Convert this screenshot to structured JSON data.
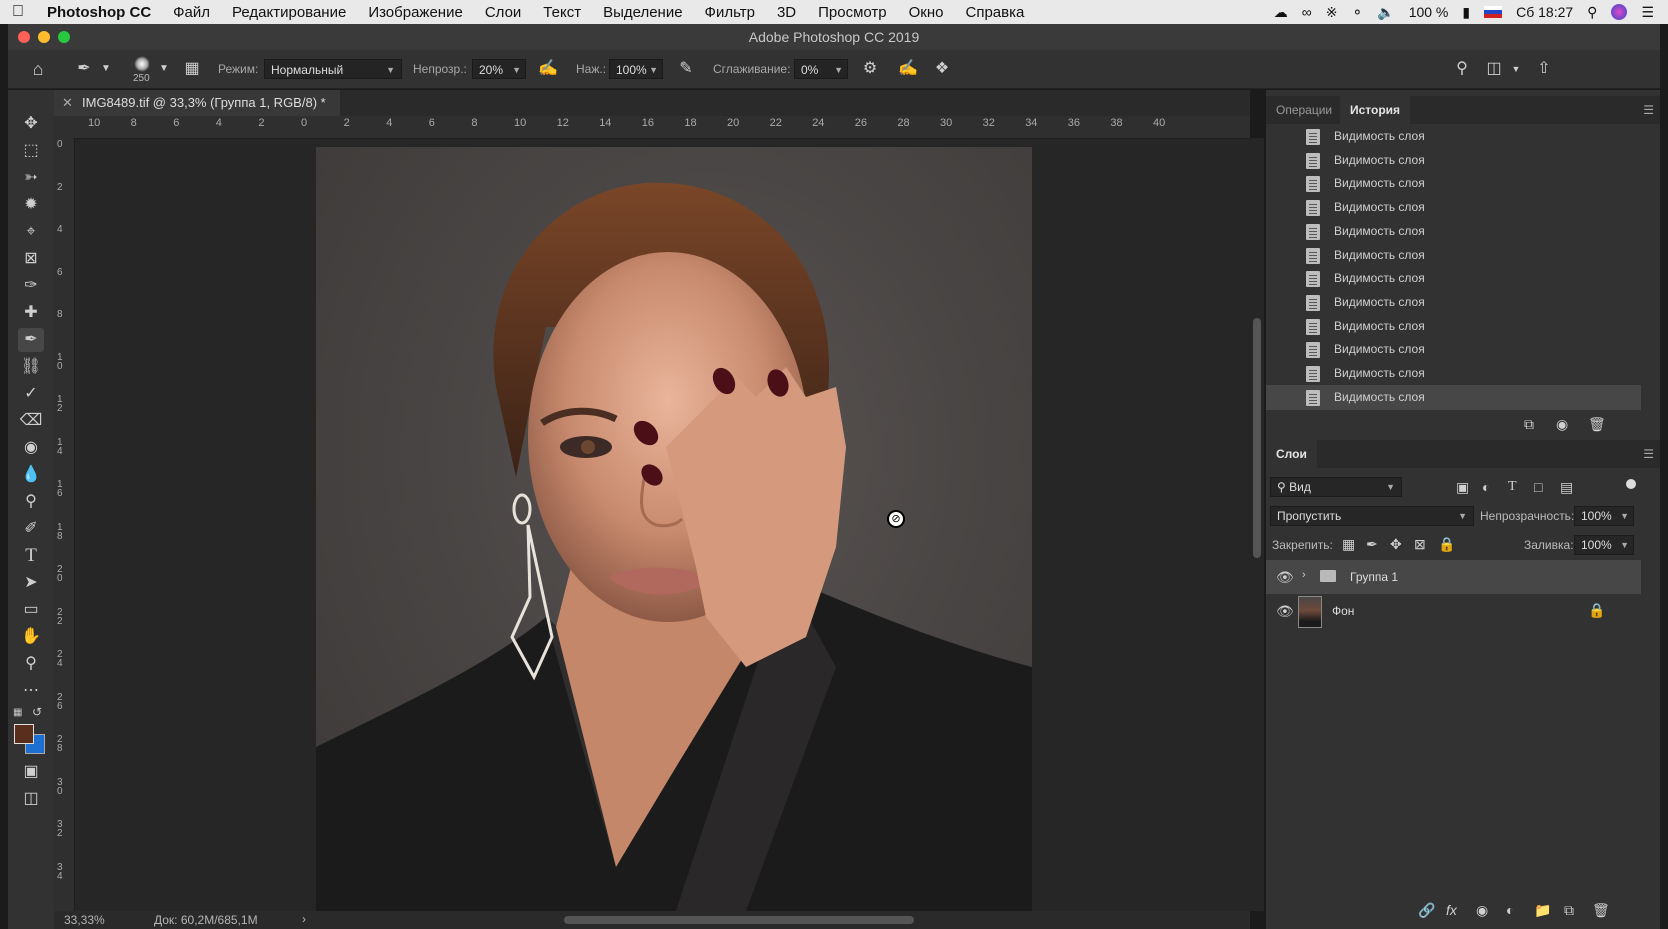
{
  "menubar": {
    "apple": "",
    "items": [
      "Photoshop CC",
      "Файл",
      "Редактирование",
      "Изображение",
      "Слои",
      "Текст",
      "Выделение",
      "Фильтр",
      "3D",
      "Просмотр",
      "Окно",
      "Справка"
    ],
    "battery": "100 %",
    "clock": "Сб 18:27"
  },
  "window": {
    "title": "Adobe Photoshop CC 2019"
  },
  "options": {
    "brush_size": "250",
    "mode_label": "Режим:",
    "mode_value": "Нормальный",
    "opacity_label": "Непрозр.:",
    "opacity_value": "20%",
    "pressure_label": "Наж.:",
    "pressure_value": "100%",
    "smoothing_label": "Сглаживание:",
    "smoothing_value": "0%"
  },
  "document": {
    "tab_title": "IMG8489.tif @ 33,3% (Группа 1, RGB/8) *",
    "ruler_top": [
      "10",
      "8",
      "6",
      "4",
      "2",
      "0",
      "2",
      "4",
      "6",
      "8",
      "10",
      "12",
      "14",
      "16",
      "18",
      "20",
      "22",
      "24",
      "26",
      "28",
      "30",
      "32",
      "34",
      "36",
      "38",
      "40"
    ],
    "ruler_left": [
      "0",
      "2",
      "4",
      "6",
      "8",
      "1 0",
      "1 2",
      "1 4",
      "1 6",
      "1 8",
      "2 0",
      "2 2",
      "2 4",
      "2 6",
      "2 8",
      "3 0",
      "3 2",
      "3 4"
    ],
    "zoom": "33,33%",
    "doc_info": "Док: 60,2M/685,1M"
  },
  "history_panel": {
    "tabs": [
      "Операции",
      "История"
    ],
    "items": [
      "Видимость слоя",
      "Видимость слоя",
      "Видимость слоя",
      "Видимость слоя",
      "Видимость слоя",
      "Видимость слоя",
      "Видимость слоя",
      "Видимость слоя",
      "Видимость слоя",
      "Видимость слоя",
      "Видимость слоя",
      "Видимость слоя"
    ]
  },
  "layers_panel": {
    "tab": "Слои",
    "filter_value": "Вид",
    "blend_mode": "Пропустить",
    "opacity_label": "Непрозрачность:",
    "opacity_value": "100%",
    "lock_label": "Закрепить:",
    "fill_label": "Заливка:",
    "fill_value": "100%",
    "layers": [
      {
        "name": "Группа 1",
        "type": "group"
      },
      {
        "name": "Фон",
        "type": "background"
      }
    ]
  },
  "colors": {
    "foreground": "#5a2e1c",
    "background": "#1d6fd1",
    "accent": "#2d7be8"
  }
}
